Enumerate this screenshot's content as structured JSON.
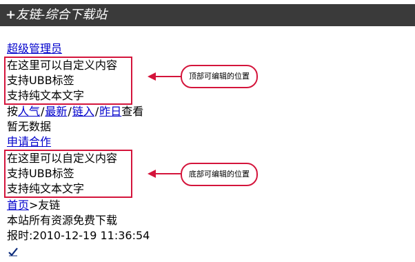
{
  "header": {
    "plus": "+",
    "title": "友链-综合下载站"
  },
  "admin_link": "超级管理员",
  "top_block": [
    "在这里可以自定义内容",
    "支持UBB标签",
    "支持纯文本文字"
  ],
  "top_note": "顶部可编辑的位置",
  "sort_bar": {
    "prefix": "按",
    "links": [
      "人气",
      "最新",
      "链入",
      "昨日"
    ],
    "separator": "/",
    "suffix": "查看"
  },
  "empty_text": "暂无数据",
  "apply_link": "申请合作",
  "bottom_block": [
    "在这里可以自定义内容",
    "支持UBB标签",
    "支持纯文本文字"
  ],
  "bottom_note": "底部可编辑的位置",
  "breadcrumb": {
    "home": "首页",
    "sep": ">",
    "current": "友链"
  },
  "free_text": "本站所有资源免费下载",
  "time_text": "报时:2010-12-19 11:36:54",
  "colors": {
    "header_bg": "#3a3a3a",
    "link": "#0000cc",
    "annotation": "#d4143b"
  },
  "icons": {
    "footer": "check-mark-icon"
  }
}
